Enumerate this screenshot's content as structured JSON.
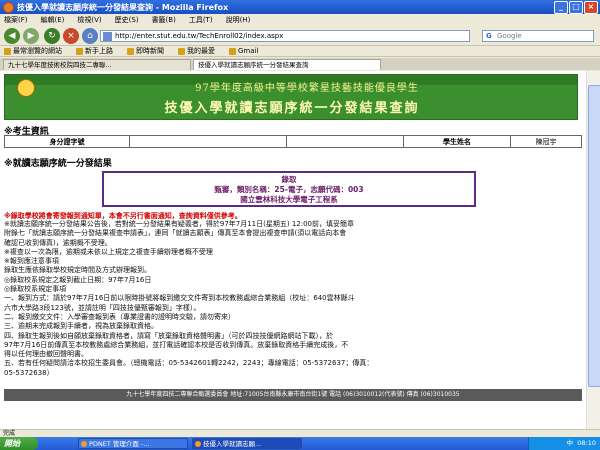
{
  "window": {
    "title": "技優入學就讀志願序統一分發結果查詢 - Mozilla Firefox"
  },
  "menu": [
    "檔案(F)",
    "編輯(E)",
    "檢視(V)",
    "歷史(S)",
    "書籤(B)",
    "工具(T)",
    "說明(H)"
  ],
  "nav": {
    "url": "http://enter.stut.edu.tw/TechEnroll02/index.aspx",
    "search_placeholder": "Google"
  },
  "bookmarks": [
    "最常瀏覽的網站",
    "新手上路",
    "即時新聞",
    "我的最愛",
    "Gmail"
  ],
  "tabs": [
    "九十七學年度技術校院四技二專聯...",
    "技優入學就讀志願序統一分發結果查詢"
  ],
  "banner": {
    "line1": "97學年度高級中等學校繁星技藝技能優良學生",
    "line2": "技優入學就讀志願序統一分發結果查詢"
  },
  "student_info": {
    "heading": "※考生資訊",
    "id_label": "身分證字號",
    "id_value": "",
    "name_label": "學生姓名",
    "name_value": "陳冠宇"
  },
  "result": {
    "heading": "※就讀志願序統一分發結果",
    "line1": "錄取",
    "line2": "甄審，類別名稱：25-電子，志願代碼：003",
    "line3": "國立雲林科技大學電子工程系"
  },
  "notice": "※錄取學校將會寄發報到通知單，本會不另行書面通知，查詢資料僅供參考。",
  "body_lines": [
    "※就讀志願序統一分發結果公告後，若對統一分發結果有疑義者，得於97年7月11日(星期五) 12:00前，填妥簡章",
    "附錄七「就讀志願序統一分發結果複查申請表」，連同「就讀志願表」傳真至本會提出複查申請(須以電話向本會",
    "確認已收到傳真)，逾期概不受理。",
    "※複查以一次為限，逾期或未依以上規定之複查手續辦理者概不受理",
    "※報到應注意事項",
    "錄取生應依錄取學校規定時間及方式辦理報到。",
    "◎錄取校系規定之報到截止日期：97年7月16日",
    "◎錄取校系規定事項",
    "一、報到方式：請於97年7月16日前以限時掛號將報到繳交文件寄到本校教務處綜合業務組（校址：640雲林縣斗",
    "六市大學路3段123號，並請註明「四技技優甄審報到」字樣）。",
    "二、報到繳交文件：入學審查報到表（專業證書的證明時交驗，請勿寄來）",
    "三、逾期未完成報到手續者，視為放棄錄取資格。",
    "四、錄取生報到後如自願放棄錄取資格者，請寫「放棄錄取資格聲明書」（可於四技技優網路網站下載），於",
    "97年7月16日前傳真至本校教務處綜合業務組，並打電話確認本校是否收到傳真。放棄錄取資格手續完成後，不",
    "得以任何理由撤回聲明書。",
    "五、若有任何疑問請洽本校招生委員會。（總機電話：05-5342601轉2242，2243；專線電話：05-5372637；傳真：",
    "05-5372638）"
  ],
  "footer": "九十七學年度四技二專聯合甄選委員會 地址:71005台南縣永康市南台街1號 電話 (06)3010012(代表號) 傳真 (06)3010035",
  "status": "完成",
  "taskbar": {
    "start": "開始",
    "tasks": [
      "PDNET 管理介面 -...",
      "技優入學就讀志願..."
    ],
    "clock": "08:10",
    "lang": "中"
  }
}
